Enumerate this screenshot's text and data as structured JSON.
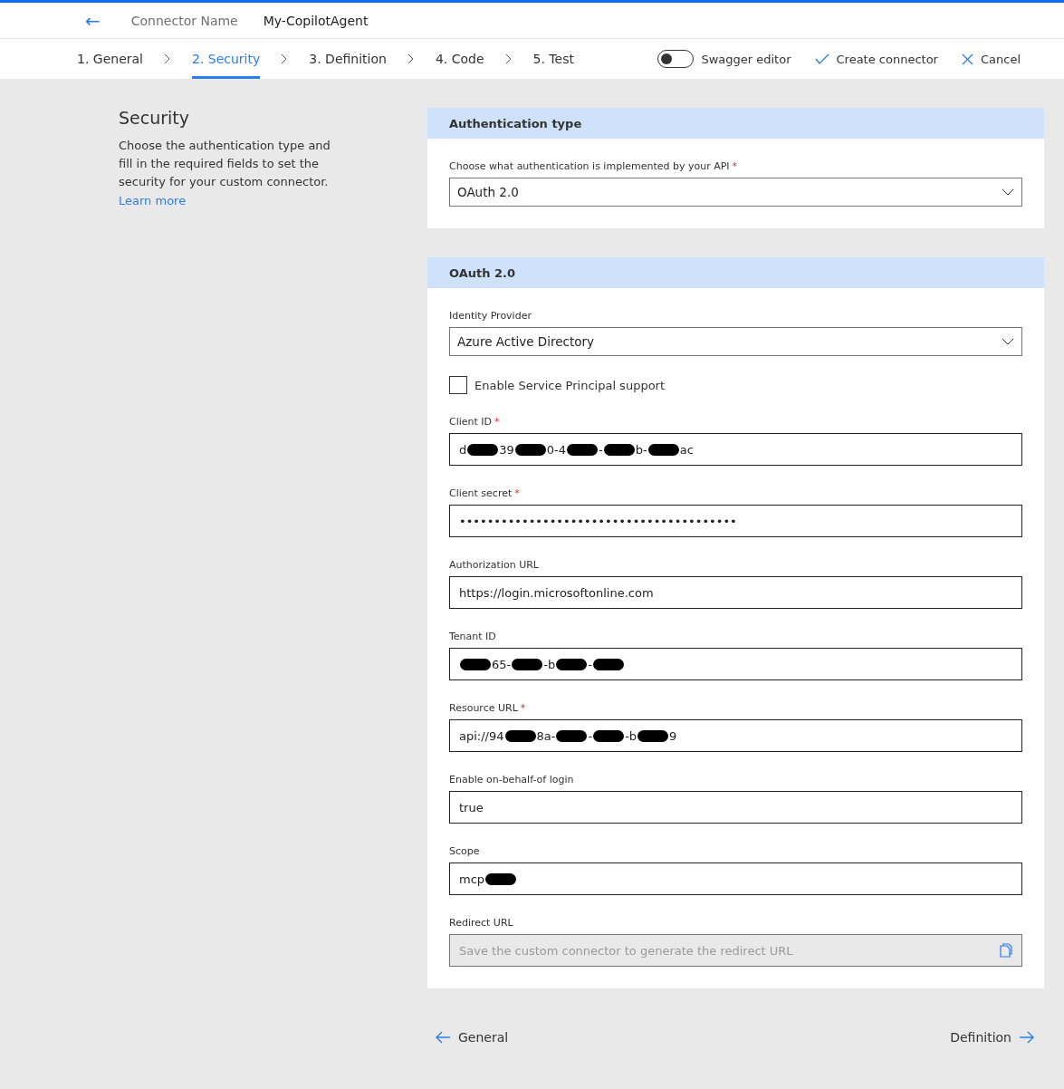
{
  "header": {
    "back_label": "←",
    "connector_name_label": "Connector Name",
    "connector_name": "My-CopilotAgent"
  },
  "steps": [
    {
      "label": "1. General",
      "selected": false
    },
    {
      "label": "2. Security",
      "selected": true
    },
    {
      "label": "3. Definition",
      "selected": false
    },
    {
      "label": "4. Code",
      "selected": false
    },
    {
      "label": "5. Test",
      "selected": false
    }
  ],
  "toolbar": {
    "swagger": {
      "label": "Swagger editor",
      "on": false
    },
    "create": "Create connector",
    "cancel": "Cancel"
  },
  "intro": {
    "title": "Security",
    "text": "Choose the authentication type and fill in the required fields to set the security for your custom connector.",
    "link": "Learn more"
  },
  "sections": [
    {
      "title": "Authentication type",
      "fields": [
        {
          "kind": "dropdown",
          "label": "Choose what authentication is implemented by your API",
          "required_mark": "*",
          "value": "OAuth 2.0"
        }
      ]
    },
    {
      "title": "OAuth 2.0",
      "fields": [
        {
          "kind": "dropdown",
          "label": "Identity Provider",
          "value": "Azure Active Directory"
        },
        {
          "kind": "checkbox",
          "label": "Enable Service Principal support",
          "checked": false
        },
        {
          "kind": "text",
          "label": "Client ID",
          "required_mark": "*",
          "parts": [
            {
              "kind": "text",
              "text": "d"
            },
            {
              "kind": "redacted"
            },
            {
              "kind": "text",
              "text": "39"
            },
            {
              "kind": "redacted"
            },
            {
              "kind": "text",
              "text": "0-4"
            },
            {
              "kind": "redacted"
            },
            {
              "kind": "text",
              "text": "-"
            },
            {
              "kind": "redacted"
            },
            {
              "kind": "text",
              "text": "b-"
            },
            {
              "kind": "redacted"
            },
            {
              "kind": "text",
              "text": "ac"
            }
          ]
        },
        {
          "kind": "text",
          "label": "Client secret",
          "required_mark": "*",
          "parts": [
            {
              "kind": "text",
              "text": "••••••••••••••••••••••••••••••••••••••••"
            }
          ]
        },
        {
          "kind": "text",
          "label": "Authorization URL",
          "parts": [
            {
              "kind": "text",
              "text": "https://login.microsoftonline.com"
            }
          ]
        },
        {
          "kind": "text",
          "label": "Tenant ID",
          "parts": [
            {
              "kind": "redacted"
            },
            {
              "kind": "text",
              "text": "65-"
            },
            {
              "kind": "redacted"
            },
            {
              "kind": "text",
              "text": "-b"
            },
            {
              "kind": "redacted"
            },
            {
              "kind": "text",
              "text": "-"
            },
            {
              "kind": "redacted"
            }
          ]
        },
        {
          "kind": "text",
          "label": "Resource URL",
          "required_mark": "*",
          "parts": [
            {
              "kind": "text",
              "text": "api://94"
            },
            {
              "kind": "redacted"
            },
            {
              "kind": "text",
              "text": "8a-"
            },
            {
              "kind": "redacted"
            },
            {
              "kind": "text",
              "text": "-"
            },
            {
              "kind": "redacted"
            },
            {
              "kind": "text",
              "text": "-b"
            },
            {
              "kind": "redacted"
            },
            {
              "kind": "text",
              "text": "9"
            }
          ]
        },
        {
          "kind": "text",
          "label": "Enable on-behalf-of login",
          "parts": [
            {
              "kind": "text",
              "text": "true"
            }
          ]
        },
        {
          "kind": "text",
          "label": "Scope",
          "parts": [
            {
              "kind": "text",
              "text": "mcp"
            },
            {
              "kind": "redacted"
            }
          ]
        },
        {
          "kind": "readonly",
          "label": "Redirect URL",
          "placeholder": "Save the custom connector to generate the redirect URL"
        }
      ]
    }
  ],
  "footer": {
    "back": "General",
    "next": "Definition"
  }
}
